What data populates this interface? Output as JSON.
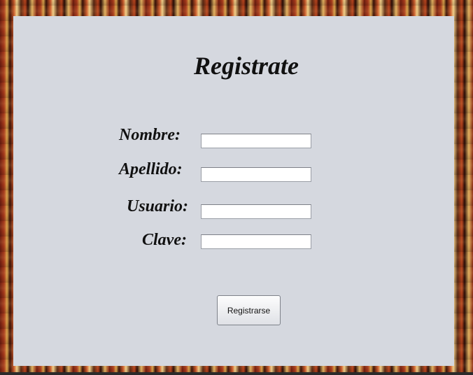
{
  "form": {
    "title": "Registrate",
    "fields": [
      {
        "label": "Nombre:",
        "value": "",
        "placeholder": ""
      },
      {
        "label": "Apellido:",
        "value": "",
        "placeholder": ""
      },
      {
        "label": "Usuario:",
        "value": "",
        "placeholder": ""
      },
      {
        "label": "Clave:",
        "value": "",
        "placeholder": ""
      }
    ],
    "submit_label": "Registrarse"
  },
  "colors": {
    "panel": "#d5d8df",
    "text": "#111111"
  }
}
